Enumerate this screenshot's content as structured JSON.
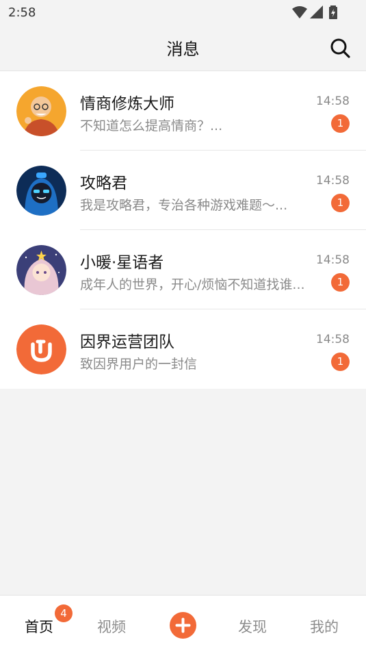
{
  "status_bar": {
    "time": "2:58",
    "icons": [
      "wifi-icon",
      "signal-icon",
      "battery-charging-icon"
    ]
  },
  "header": {
    "title": "消息",
    "search_icon": "search-icon"
  },
  "conversations": [
    {
      "name": "情商修炼大师",
      "time": "14:58",
      "preview": "不知道怎么提高情商？...",
      "unread": "1",
      "avatar": "monk-avatar"
    },
    {
      "name": "攻略君",
      "time": "14:58",
      "preview": "我是攻略君，专治各种游戏难题～...",
      "unread": "1",
      "avatar": "gamer-avatar"
    },
    {
      "name": "小暖·星语者",
      "time": "14:58",
      "preview": "成年人的世界，开心/烦恼不知道找谁...",
      "unread": "1",
      "avatar": "star-girl-avatar"
    },
    {
      "name": "因界运营团队",
      "time": "14:58",
      "preview": "致因界用户的一封信",
      "unread": "1",
      "avatar": "yinjie-logo-avatar"
    }
  ],
  "tabbar": {
    "items": [
      {
        "label": "首页",
        "badge": "4",
        "active": true
      },
      {
        "label": "视频"
      },
      {
        "label": "发现"
      },
      {
        "label": "我的"
      }
    ],
    "add_icon": "plus-icon"
  },
  "colors": {
    "accent": "#f26a38",
    "background": "#f3f3f3"
  }
}
